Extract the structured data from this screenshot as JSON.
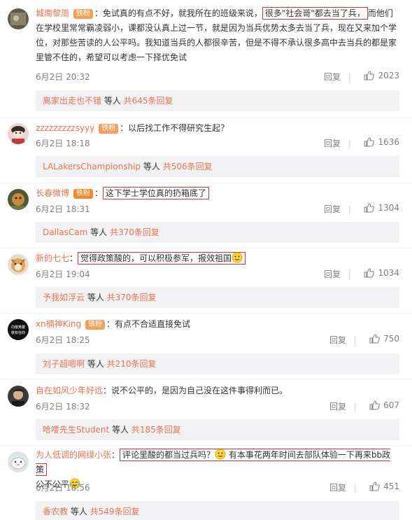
{
  "comments": [
    {
      "name": "城南黎周",
      "badge": "铁粉",
      "text_pre": "：免试真的有点不好，就我所在的班级来说，",
      "text_hl": "很多\"社会哥\"都去当了兵，",
      "text_post": "而他们在学校里常常霸凌弱小，课都没认真上过一节，就是因为当兵优势太多去当了兵，现在又来加个学位，对那些苦读的人公平吗。我知道当兵的人都很辛苦，但是不得不承认很多高中去当兵的都是家里管不住的，希望可以考虑一下择优免试",
      "time": "6月2日 20:32",
      "reply": "回复",
      "likes": "2023",
      "sub_who": "离家出走也不错",
      "sub_mid": " 等人 ",
      "sub_cnt": "共645条回复"
    },
    {
      "name": "zzzzzzzzzsyyy",
      "badge": "铁粉",
      "text": "：以后找工作不得研究生起？",
      "time": "6月2日 18:18",
      "reply": "回复",
      "likes": "1636",
      "sub_who": "LALakersChampionship",
      "sub_mid": " 等人 ",
      "sub_cnt": "共506条回复"
    },
    {
      "name": "长春微博",
      "badge": "铁粉",
      "text_hl": "这下学士学位真的扔箱底了",
      "time": "6月2日 18:31",
      "reply": "回复",
      "likes": "1304",
      "sub_who": "DallasCam",
      "sub_mid": " 等人 ",
      "sub_cnt": "共370条回复"
    },
    {
      "name": "新的七七",
      "text_hl": "觉得政策酸的，可以积极参军，报效祖国",
      "time": "6月2日 19:04",
      "reply": "回复",
      "likes": "1034",
      "sub_who": "予我如浮云",
      "sub_mid": " 等人 ",
      "sub_cnt": "共370条回复"
    },
    {
      "name": "xn楠神King",
      "badge": "铁粉",
      "text": "：有点不合适直接免试",
      "avatar_text": "向敬英雄 敬有信仰",
      "time": "6月2日 18:25",
      "reply": "回复",
      "likes": "750",
      "sub_who": "刘子超嗯啊",
      "sub_mid": " 等人 ",
      "sub_cnt": "共210条回复"
    },
    {
      "name": "自在如风少年好远",
      "text": "：说不公平的，是因为自己没在这件事得利而已。",
      "time": "6月2日 18:32",
      "reply": "回复",
      "likes": "607",
      "sub_who": "哈喽先生Student",
      "sub_mid": " 等人 ",
      "sub_cnt": "共185条回复"
    },
    {
      "name": "为人低调的网绿小张",
      "text_hl": "评论里酸的都当过兵吗？",
      "text_post": "有本事花两年时间去部队体验一下再来bb政策",
      "text_tail": "公不公平",
      "time": "6月2日 18:56",
      "reply": "回复",
      "likes": "451",
      "sub_who": "香农教",
      "sub_mid": " 等人 ",
      "sub_cnt": "共549条回复"
    }
  ],
  "colors": {
    "name": "#eb7350",
    "highlight_border": "#e0302b",
    "meta": "#808080",
    "subbox_bg": "#f2f2f5"
  }
}
